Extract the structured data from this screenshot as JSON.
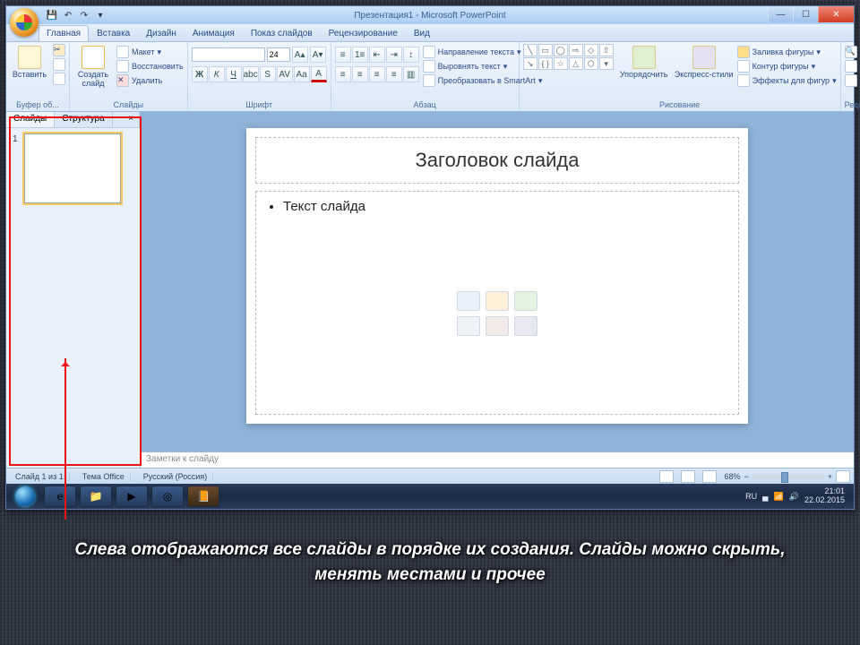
{
  "window": {
    "title": "Презентация1 - Microsoft PowerPoint"
  },
  "tabs": {
    "home": "Главная",
    "insert": "Вставка",
    "design": "Дизайн",
    "animation": "Анимация",
    "slideshow": "Показ слайдов",
    "review": "Рецензирование",
    "view": "Вид"
  },
  "ribbon": {
    "paste": "Вставить",
    "clipboard_label": "Буфер об...",
    "new_slide": "Создать\nслайд",
    "layout": "Макет",
    "reset": "Восстановить",
    "delete": "Удалить",
    "slides_label": "Слайды",
    "font_size": "24",
    "font_label": "Шрифт",
    "para_label": "Абзац",
    "text_direction": "Направление текста",
    "align_text": "Выровнять текст",
    "convert_smartart": "Преобразовать в SmartArt",
    "arrange": "Упорядочить",
    "quick_styles": "Экспресс-стили",
    "drawing_label": "Рисование",
    "shape_fill": "Заливка фигуры",
    "shape_outline": "Контур фигуры",
    "shape_effects": "Эффекты для фигур",
    "find": "Найти",
    "replace": "Заменить",
    "select": "Выделить",
    "editing_label": "Редактирование"
  },
  "side": {
    "tab_slides": "Слайды",
    "tab_outline": "Структура",
    "close": "×"
  },
  "slide": {
    "title_placeholder": "Заголовок слайда",
    "body_placeholder": "Текст слайда"
  },
  "notes": {
    "placeholder": "Заметки к слайду"
  },
  "status": {
    "slide_counter": "Слайд 1 из 1",
    "theme": "Тема Office",
    "language": "Русский (Россия)",
    "zoom": "68%"
  },
  "tray": {
    "lang": "RU",
    "time": "21:01",
    "date": "22.02.2015"
  },
  "caption": "Слева отображаются все слайды в порядке их создания. Слайды можно скрыть, менять местами и прочее"
}
